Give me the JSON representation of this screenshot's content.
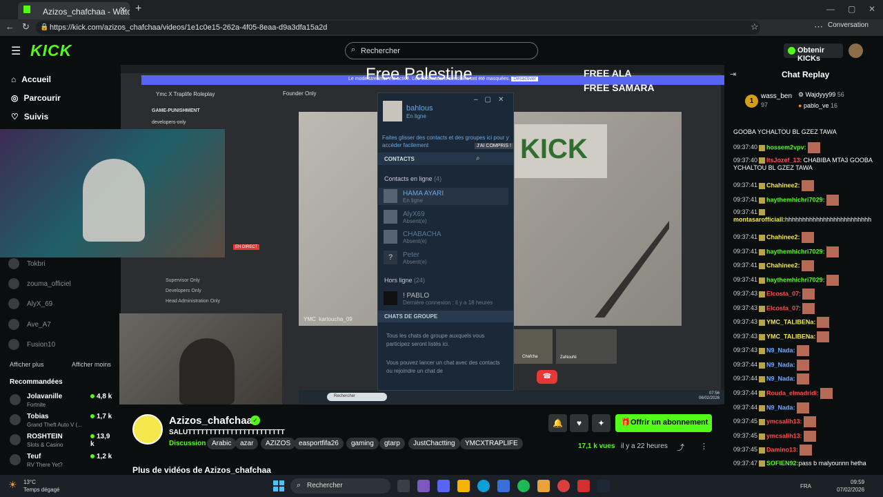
{
  "browser": {
    "tab_title": "Azizos_chafchaa - Watch the",
    "url": "https://kick.com/azizos_chafchaa/videos/1e1c0e15-262a-4f05-8eaa-d9a3dfa15a2d",
    "conversation_label": "Conversation"
  },
  "header": {
    "logo": "KICK",
    "search_placeholder": "Rechercher",
    "obtenir_label": "Obtenir KICKs"
  },
  "sidebar": {
    "nav": [
      {
        "label": "Accueil",
        "icon": "home-icon"
      },
      {
        "label": "Parcourir",
        "icon": "compass-icon"
      },
      {
        "label": "Suivis",
        "icon": "heart-icon"
      }
    ],
    "followed": [
      "Tokbri",
      "zouma_officiel",
      "AlyX_69",
      "Ave_A7",
      "Fusion10"
    ],
    "show_more": "Afficher plus",
    "show_less": "Afficher moins",
    "recommended_title": "Recommandées",
    "recommended": [
      {
        "name": "Jolavanille",
        "category": "Fortnite",
        "count": "4,8 k"
      },
      {
        "name": "Tobias",
        "category": "Grand Theft Auto V (...",
        "count": "1,7 k"
      },
      {
        "name": "ROSHTEIN",
        "category": "Slots & Casino",
        "count": "13,9 k"
      },
      {
        "name": "Teuf",
        "category": "RV There Yet?",
        "count": "1,2 k"
      }
    ]
  },
  "stream": {
    "banner_text": "Free Palestine",
    "overlay_right_1": "FREE ALA",
    "overlay_right_2": "FREE SAMARA",
    "discord_notice": "Le mode streamer est activé. Les informations sensibles ont été masquées.",
    "discord_disable": "Désactiver",
    "channel_group": "Ymc X Traplife Roleplay",
    "channels": [
      "GAME-PUNISHMENT",
      "developers-only"
    ],
    "voice_channels": [
      "Supervisor Only",
      "Developers Only",
      "Head Administration Only"
    ],
    "founder_label": "Founder Only",
    "video_user_label": "kartoucha_09",
    "video_tag": "YMC",
    "poster_text": "KICK",
    "steam": {
      "user": "bahlous",
      "status": "En ligne",
      "drag_hint": "Faites glisser des contacts et des groupes ici pour y accéder facilement",
      "understood": "J'AI COMPRIS !",
      "contacts_header": "CONTACTS",
      "online_section": "Contacts en ligne",
      "online_count": "(4)",
      "online": [
        {
          "name": "HAMA AYARI",
          "status": "En ligne"
        },
        {
          "name": "AlyX69",
          "status": "Absent(e)"
        },
        {
          "name": "CHABACHA",
          "status": "Absent(e)"
        },
        {
          "name": "Peter",
          "status": "Absent(e)"
        }
      ],
      "offline_section": "Hors ligne",
      "offline_count": "(24)",
      "offline": [
        {
          "name": "! PABLO",
          "status": "Dernière connexion : il y a 18 heures"
        }
      ],
      "group_header": "CHATS DE GROUPE",
      "group_text_1": "Tous les chats de groupe auxquels vous participez seront listés ici.",
      "group_text_2": "Vous pouvez lancer un chat avec des contacts ou rejoindre un chat de"
    },
    "call_tiles": [
      "Chafcha",
      "ZaNouNi"
    ],
    "video_taskbar_search": "Rechercher",
    "video_time": "07:56",
    "video_date": "06/02/2026",
    "en_direct": "EN DIRECT"
  },
  "channel": {
    "name": "Azizos_chafchaa",
    "title": "SALUTTTTTTTTTTTTTTTTTTTTTTT",
    "category": "Discussion",
    "tags": [
      "Arabic",
      "azar",
      "AZIZOS",
      "easportfifa26",
      "gaming",
      "gtarp",
      "JustChactting",
      "YMCXTRAPLIFE"
    ],
    "subscribe_label": "Offrir un abonnement",
    "views": "17,1 k vues",
    "ago": "il y a 22 heures",
    "more_videos": "Plus de vidéos de Azizos_chafchaa"
  },
  "chat": {
    "title": "Chat Replay",
    "top_gifters": [
      {
        "rank": "1",
        "name": "wass_ben",
        "count": "97"
      },
      {
        "name": "Wajdyyy99",
        "count": "56"
      },
      {
        "name": "pablo_ve",
        "count": "16"
      }
    ],
    "messages": [
      {
        "time": "",
        "user": "",
        "text": "GOOBA YCHALTOU BL GZEZ TAWA",
        "color": "#ffffff"
      },
      {
        "time": "09:37:40",
        "user": "hossem2vpv:",
        "text": "",
        "color": "#53fc18"
      },
      {
        "time": "09:37:40",
        "user": "ItsJozef_13",
        "text": ": CHABIBA MTA3 GOOBA YCHALTOU BL GZEZ TAWA",
        "color": "#ff4d4d"
      },
      {
        "time": "09:37:41",
        "user": "Chahinee2:",
        "text": "",
        "color": "#f4e84e"
      },
      {
        "time": "09:37:41",
        "user": "haythemhichri7029:",
        "text": "",
        "color": "#53fc18"
      },
      {
        "time": "09:37:41",
        "user": "montasarofficiall:",
        "text": "hhhhhhhhhhhhhhhhhhhhhhhhh",
        "color": "#f4e84e"
      },
      {
        "time": "09:37:41",
        "user": "Chahinee2:",
        "text": "",
        "color": "#f4e84e"
      },
      {
        "time": "09:37:41",
        "user": "haythemhichri7029:",
        "text": "",
        "color": "#53fc18"
      },
      {
        "time": "09:37:41",
        "user": "Chahinee2:",
        "text": "",
        "color": "#f4e84e"
      },
      {
        "time": "09:37:41",
        "user": "haythemhichri7029:",
        "text": "",
        "color": "#53fc18"
      },
      {
        "time": "09:37:43",
        "user": "Elcosta_07",
        "text": ":",
        "color": "#ff4d4d"
      },
      {
        "time": "09:37:43",
        "user": "Elcosta_07",
        "text": ":",
        "color": "#ff4d4d"
      },
      {
        "time": "09:37:43",
        "user": "YMC_TALIBENa:",
        "text": "",
        "color": "#f4e84e"
      },
      {
        "time": "09:37:43",
        "user": "YMC_TALIBENa:",
        "text": "",
        "color": "#f4e84e"
      },
      {
        "time": "09:37:43",
        "user": "N9_Nada:",
        "text": "",
        "color": "#6fa8ff"
      },
      {
        "time": "09:37:44",
        "user": "N9_Nada:",
        "text": "",
        "color": "#6fa8ff"
      },
      {
        "time": "09:37:44",
        "user": "N9_Nada:",
        "text": "",
        "color": "#6fa8ff"
      },
      {
        "time": "09:37:44",
        "user": "Rouda_elmadridi:",
        "text": "",
        "color": "#ff4d4d"
      },
      {
        "time": "09:37:44",
        "user": "N9_Nada:",
        "text": "",
        "color": "#6fa8ff"
      },
      {
        "time": "09:37:45",
        "user": "ymcsalih13:",
        "text": "",
        "color": "#ff4d4d"
      },
      {
        "time": "09:37:45",
        "user": "ymcsalih13:",
        "text": "",
        "color": "#ff4d4d"
      },
      {
        "time": "09:37:45",
        "user": "Damino13:",
        "text": "",
        "color": "#ff4d4d"
      },
      {
        "time": "09:37:47",
        "user": "SOFIEN92:",
        "text": "pass b malyounnn hetha",
        "color": "#53fc18"
      }
    ]
  },
  "taskbar": {
    "temp": "13°C",
    "weather": "Temps dégagé",
    "search": "Rechercher",
    "lang": "FRA",
    "time": "09:59",
    "date": "07/02/2026"
  },
  "colors": {
    "accent": "#53fc18",
    "background": "#0b0e0f"
  }
}
